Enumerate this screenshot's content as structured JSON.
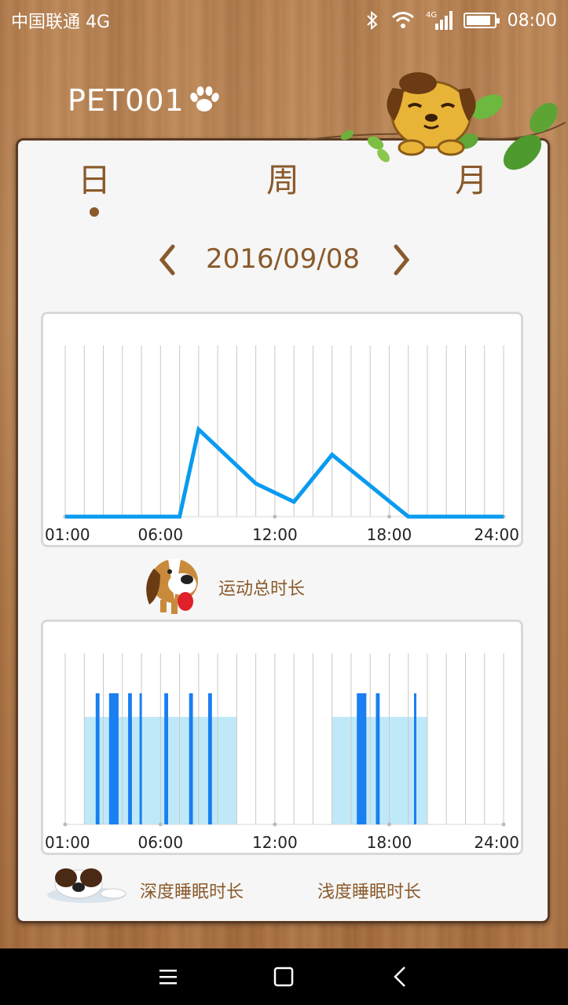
{
  "status_bar": {
    "carrier": "中国联通 4G",
    "network": "4G",
    "time": "08:00",
    "battery_level": 0.9
  },
  "header": {
    "pet_name": "PET001",
    "icons": [
      "paw-icon",
      "dog-mascot-icon",
      "leaves-decoration"
    ]
  },
  "tabs": [
    {
      "label": "日",
      "selected": true
    },
    {
      "label": "周",
      "selected": false
    },
    {
      "label": "月",
      "selected": false
    }
  ],
  "date_nav": {
    "date": "2016/09/08",
    "prev_icon": "chevron-left-icon",
    "next_icon": "chevron-right-icon"
  },
  "colors": {
    "accent_brown": "#8a5a2b",
    "activity_line": "#0a9bf0",
    "deep_sleep": "#1a7ff0",
    "light_sleep": "#bfe9f9"
  },
  "chart_data": [
    {
      "type": "line",
      "x_ticks": [
        "01:00",
        "06:00",
        "12:00",
        "18:00",
        "24:00"
      ],
      "x": [
        1,
        7,
        8,
        11,
        13,
        15,
        19,
        24
      ],
      "values": [
        0,
        0,
        1.0,
        0.38,
        0.17,
        0.71,
        0,
        0
      ],
      "xlim": [
        1,
        24
      ],
      "grid": "vertical"
    },
    {
      "type": "bar",
      "x_ticks": [
        "01:00",
        "06:00",
        "12:00",
        "18:00",
        "24:00"
      ],
      "xlim": [
        1,
        24
      ],
      "grid": "vertical",
      "light_sleep_ranges": [
        [
          2.0,
          10.0
        ],
        [
          15.0,
          20.0
        ]
      ],
      "deep_sleep_ranges": [
        [
          2.6,
          2.8
        ],
        [
          3.3,
          3.8
        ],
        [
          4.3,
          4.5
        ],
        [
          4.9,
          5.0
        ],
        [
          6.2,
          6.4
        ],
        [
          7.5,
          7.7
        ],
        [
          8.5,
          8.7
        ],
        [
          16.3,
          16.8
        ],
        [
          17.3,
          17.5
        ],
        [
          19.3,
          19.4
        ]
      ]
    }
  ],
  "legend": {
    "activity_label": "运动总时长",
    "deep_sleep_label": "深度睡眠时长",
    "light_sleep_label": "浅度睡眠时长"
  },
  "nav_bar": {
    "icons": [
      "menu-icon",
      "home-square-icon",
      "back-icon"
    ]
  }
}
